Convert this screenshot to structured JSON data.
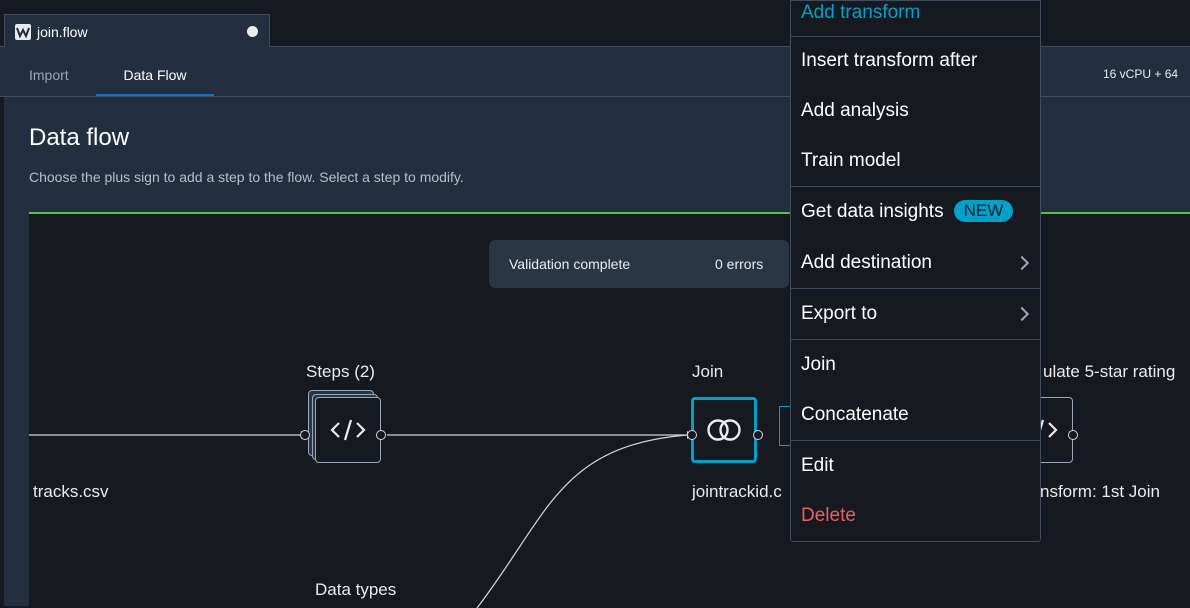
{
  "tabs": {
    "file_name": "join.flow"
  },
  "subnav": {
    "import_label": "Import",
    "dataflow_label": "Data Flow",
    "resources": "16 vCPU + 64"
  },
  "page": {
    "title": "Data flow",
    "description": "Choose the plus sign to add a step to the flow. Select a step to modify."
  },
  "validation": {
    "status": "Validation complete",
    "errors": "0 errors"
  },
  "nodes": {
    "source_label": "tracks.csv",
    "steps_label": "Steps (2)",
    "join_label": "Join",
    "join_sublabel": "jointrackid.c",
    "transform_label": "ulate 5-star rating",
    "transform_sublabel": "nsform: 1st Join",
    "datatypes_label": "Data types"
  },
  "context_menu": {
    "items": [
      "Add transform",
      "Insert transform after",
      "Add analysis",
      "Train model",
      "Get data insights",
      "Add destination",
      "Export to",
      "Join",
      "Concatenate",
      "Edit",
      "Delete"
    ],
    "new_badge": "NEW"
  },
  "colors": {
    "accent": "#00a1c9",
    "tab_underline": "#0972d3",
    "progress_green": "#58c14d",
    "danger": "#eb5f5f",
    "panel": "#232f3e",
    "canvas": "#16191f"
  },
  "icons": [
    "sagemaker-logo-icon",
    "unsaved-dot-icon",
    "code-icon",
    "join-icon",
    "chevron-right-icon"
  ]
}
